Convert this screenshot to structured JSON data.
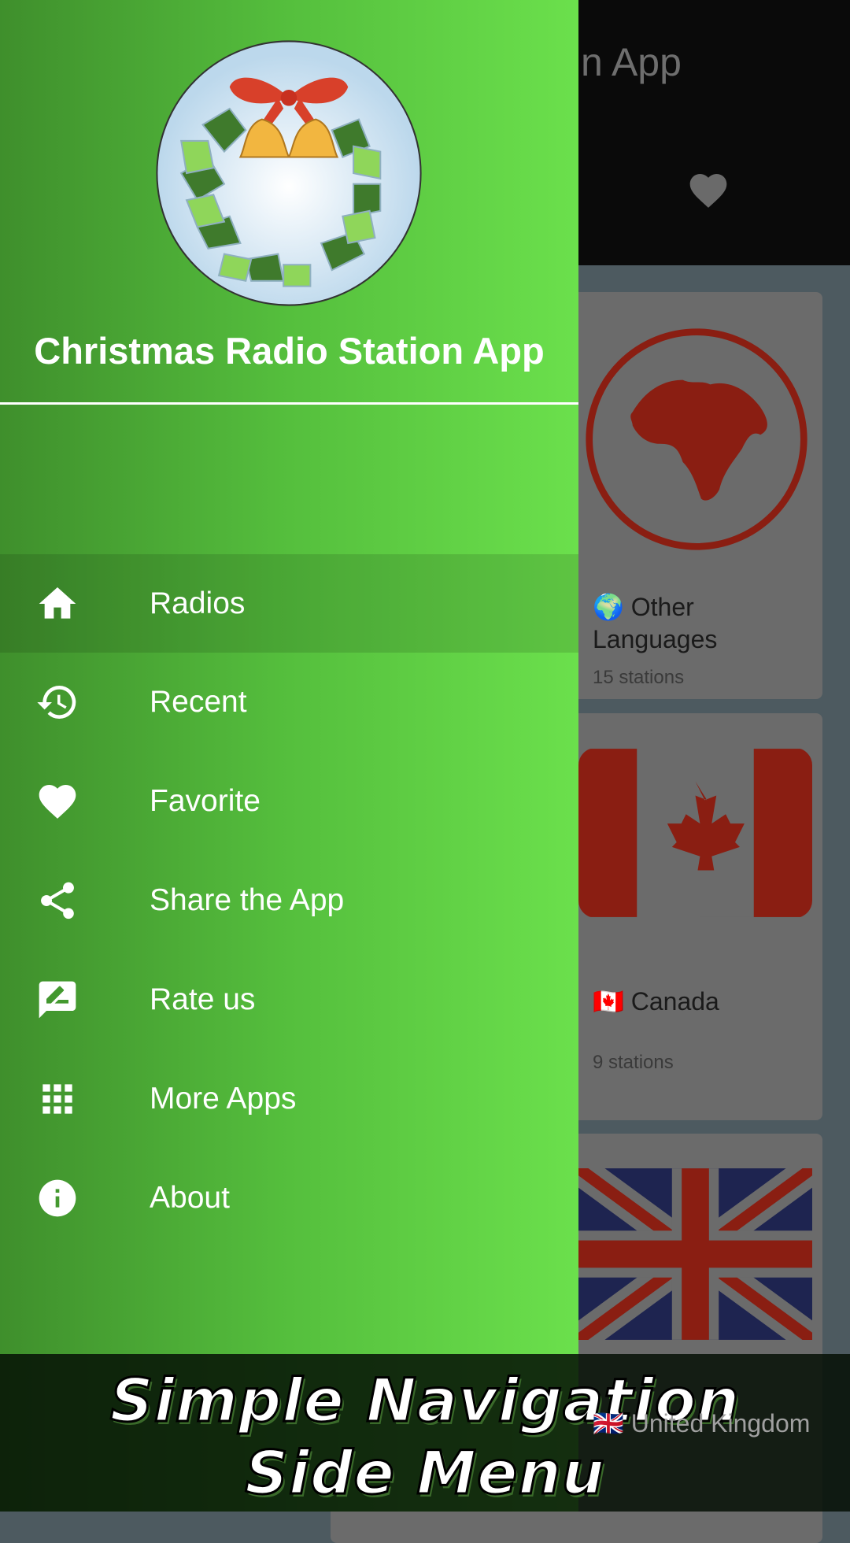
{
  "app_bar": {
    "title_visible": "n App",
    "favorite_icon": "heart-icon"
  },
  "cards": [
    {
      "emoji": "🌍",
      "label": "Other Languages",
      "count": "15 stations",
      "image": "globe-africa"
    },
    {
      "emoji": "🇨🇦",
      "label": "Canada",
      "count": "9 stations",
      "image": "canada-flag"
    },
    {
      "emoji": "🇬🇧",
      "label": "United Kingdom",
      "count": "",
      "image": "uk-flag"
    }
  ],
  "drawer": {
    "title": "Christmas Radio Station App",
    "logo": "christmas-wreath-bells",
    "items": [
      {
        "label": "Radios",
        "icon": "home-icon",
        "selected": true
      },
      {
        "label": "Recent",
        "icon": "history-icon"
      },
      {
        "label": "Favorite",
        "icon": "heart-icon"
      },
      {
        "label": "Share the App",
        "icon": "share-icon"
      },
      {
        "label": "Rate us",
        "icon": "rate-review-icon"
      },
      {
        "label": "More Apps",
        "icon": "apps-grid-icon"
      },
      {
        "label": "About",
        "icon": "info-icon"
      }
    ]
  },
  "banner": {
    "line1": "Simple Navigation",
    "line2": "Side Menu"
  },
  "colors": {
    "drawer_start": "#3f8f2c",
    "drawer_end": "#6be04c",
    "flag_red": "#c62a1a"
  }
}
